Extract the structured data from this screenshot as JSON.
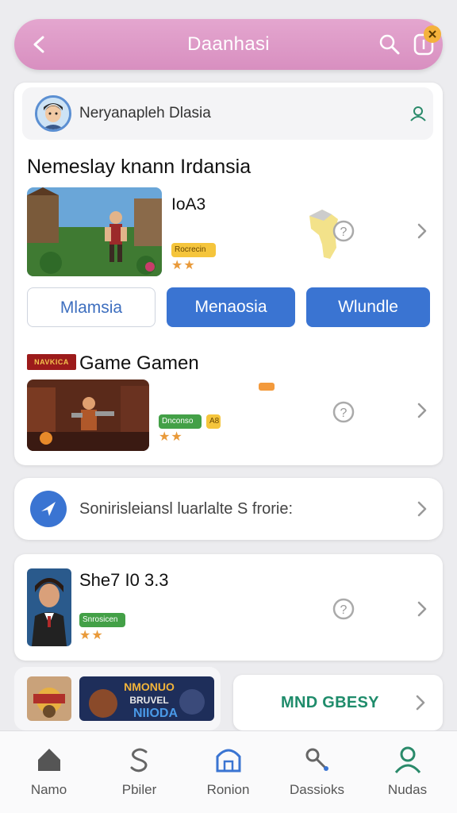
{
  "header": {
    "title": "Daanhasi"
  },
  "user_row": {
    "name": "Neryanaplеh Dlasia"
  },
  "section1": {
    "title": "Nemeslay knann Irdansia",
    "game": {
      "name": "IoA3",
      "tag": "Rocrecin",
      "stars": "★★"
    }
  },
  "buttons": [
    "Mlamsia",
    "Menaosia",
    "Wlundle"
  ],
  "section2": {
    "logo_text": "NAVKICA",
    "title": "Game Gamen",
    "game": {
      "tag": "Dnconso",
      "tag2": "A8",
      "stars": "★★"
    }
  },
  "promo": {
    "text": "Sonirisleiansl luarlalte S frorie:"
  },
  "section3": {
    "game": {
      "name": "She7 I0 3.3",
      "tag": "Snrosicen",
      "stars": "★★"
    }
  },
  "banner": {
    "text_top": "NMONUO",
    "text_mid": "BRUVEL",
    "text_bot": "NIIODA"
  },
  "cta": {
    "label": "MND GBESY"
  },
  "bottom_nav": [
    {
      "label": "Namo",
      "icon": "home-icon"
    },
    {
      "label": "Pbiler",
      "icon": "s-curve-icon"
    },
    {
      "label": "Ronion",
      "icon": "store-icon"
    },
    {
      "label": "Dassioks",
      "icon": "key-icon"
    },
    {
      "label": "Nudas",
      "icon": "user-icon"
    }
  ],
  "colors": {
    "header": "#d88fc0",
    "accent_blue": "#3a74d2",
    "star": "#e99a3a",
    "green": "#43a047"
  }
}
